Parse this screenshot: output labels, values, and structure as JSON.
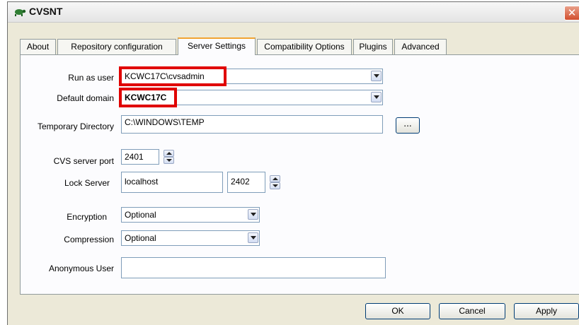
{
  "window": {
    "title": "CVSNT",
    "close_glyph": "✕",
    "app_icon": "cvsnt-turtle-icon"
  },
  "tabs": [
    {
      "label": "About"
    },
    {
      "label": "Repository configuration"
    },
    {
      "label": "Server Settings",
      "active": true
    },
    {
      "label": "Compatibility Options"
    },
    {
      "label": "Plugins"
    },
    {
      "label": "Advanced"
    }
  ],
  "form": {
    "run_as_user": {
      "label": "Run as user",
      "value": "KCWC17C\\cvsadmin"
    },
    "default_domain": {
      "label": "Default domain",
      "value": "KCWC17C"
    },
    "temp_dir": {
      "label": "Temporary Directory",
      "value": "C:\\WINDOWS\\TEMP",
      "browse_label": "..."
    },
    "server_port": {
      "label": "CVS server port",
      "value": "2401"
    },
    "lock_server": {
      "label": "Lock Server",
      "host": "localhost",
      "port": "2402"
    },
    "encryption": {
      "label": "Encryption",
      "value": "Optional"
    },
    "compression": {
      "label": "Compression",
      "value": "Optional"
    },
    "anonymous_user": {
      "label": "Anonymous User",
      "value": ""
    }
  },
  "buttons": {
    "ok": "OK",
    "cancel": "Cancel",
    "apply": "Apply"
  },
  "colors": {
    "highlight": "#e00000",
    "active_tab_accent": "#f1a432",
    "dialog_bg": "#ece9d8"
  }
}
